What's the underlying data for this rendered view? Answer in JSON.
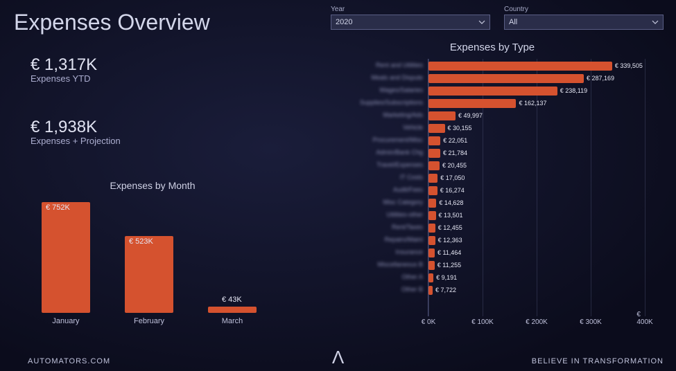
{
  "title": "Expenses Overview",
  "filters": {
    "year": {
      "label": "Year",
      "value": "2020"
    },
    "country": {
      "label": "Country",
      "value": "All"
    }
  },
  "kpi": {
    "ytd": {
      "value": "€ 1,317K",
      "label": "Expenses YTD"
    },
    "proj": {
      "value": "€ 1,938K",
      "label": "Expenses + Projection"
    }
  },
  "chart_data": [
    {
      "id": "by_month",
      "type": "bar",
      "title": "Expenses by Month",
      "categories": [
        "January",
        "February",
        "March"
      ],
      "values": [
        752,
        523,
        43
      ],
      "value_labels": [
        "€ 752K",
        "€ 523K",
        "€ 43K"
      ],
      "ylabel": "",
      "unit": "K€",
      "ylim": [
        0,
        800
      ]
    },
    {
      "id": "by_type",
      "type": "bar_horizontal",
      "title": "Expenses by Type",
      "categories": [
        "Rent and Utilities",
        "Meals and Dispute",
        "Wages/Salaries",
        "Supplies/Subscriptions",
        "Marketing/Ads",
        "Vehicle",
        "Procurement/Misc",
        "Admin/Bank Chg",
        "Travel/Expenses",
        "IT Costs",
        "Audit/Fees",
        "Misc Category",
        "Utilities-other",
        "Rent/Taxes",
        "Repairs/Maint",
        "Insurance",
        "Miscellaneous B",
        "Other A",
        "Other B"
      ],
      "values": [
        339505,
        287169,
        238119,
        162137,
        49997,
        30155,
        22051,
        21784,
        20455,
        17050,
        16274,
        14628,
        13501,
        12455,
        12363,
        11464,
        11255,
        9191,
        7722
      ],
      "value_labels": [
        "€ 339,505",
        "€ 287,169",
        "€ 238,119",
        "€ 162,137",
        "€ 49,997",
        "€ 30,155",
        "€ 22,051",
        "€ 21,784",
        "€ 20,455",
        "€ 17,050",
        "€ 16,274",
        "€ 14,628",
        "€ 13,501",
        "€ 12,455",
        "€ 12,363",
        "€ 11,464",
        "€ 11,255",
        "€ 9,191",
        "€ 7,722"
      ],
      "xlim": [
        0,
        400000
      ],
      "xticks": [
        0,
        100000,
        200000,
        300000,
        400000
      ],
      "xtick_labels": [
        "€ 0K",
        "€ 100K",
        "€ 200K",
        "€ 300K",
        "€ 400K"
      ]
    }
  ],
  "footer": {
    "left": "AUTOMATORS.COM",
    "right": "BELIEVE IN TRANSFORMATION",
    "logo": "Λ"
  }
}
